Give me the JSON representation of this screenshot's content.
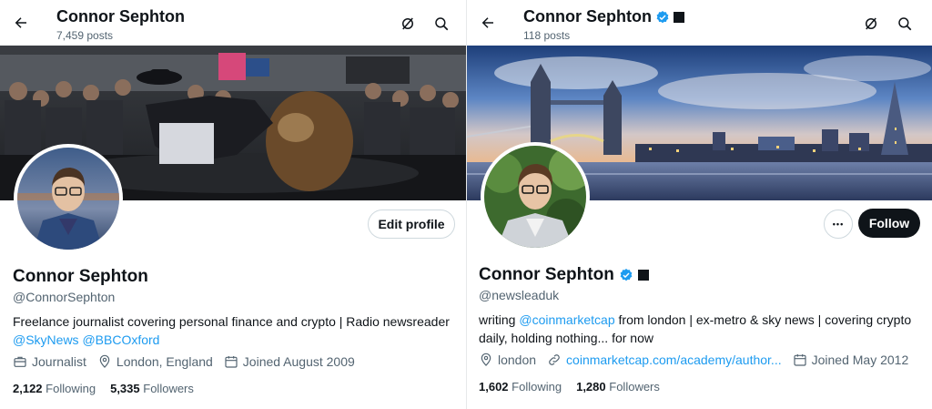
{
  "left": {
    "header": {
      "title": "Connor Sephton",
      "posts": "7,459 posts"
    },
    "edit_profile_label": "Edit profile",
    "name": "Connor Sephton",
    "handle": "@ConnorSephton",
    "bio": "Freelance journalist covering personal finance and crypto | Radio newsreader",
    "bio_mentions": [
      "@SkyNews",
      "@BBCOxford"
    ],
    "meta": {
      "profession": "Journalist",
      "location": "London, England",
      "joined": "Joined August 2009"
    },
    "following_count": "2,122",
    "following_label": "Following",
    "followers_count": "5,335",
    "followers_label": "Followers"
  },
  "right": {
    "header": {
      "title": "Connor Sephton",
      "posts": "118 posts"
    },
    "follow_label": "Follow",
    "more_label": "•••",
    "name": "Connor Sephton",
    "handle": "@newsleaduk",
    "bio_prefix": "writing",
    "bio_mention": "@coinmarketcap",
    "bio_rest": "from london | ex-metro & sky news | covering crypto daily, holding nothing... for now",
    "meta": {
      "location": "london",
      "website": "coinmarketcap.com/academy/author...",
      "joined": "Joined May 2012"
    },
    "following_count": "1,602",
    "following_label": "Following",
    "followers_count": "1,280",
    "followers_label": "Followers"
  },
  "colors": {
    "accent": "#1d9bf0",
    "text": "#0f1419",
    "muted": "#536471",
    "border": "#cfd9de"
  }
}
